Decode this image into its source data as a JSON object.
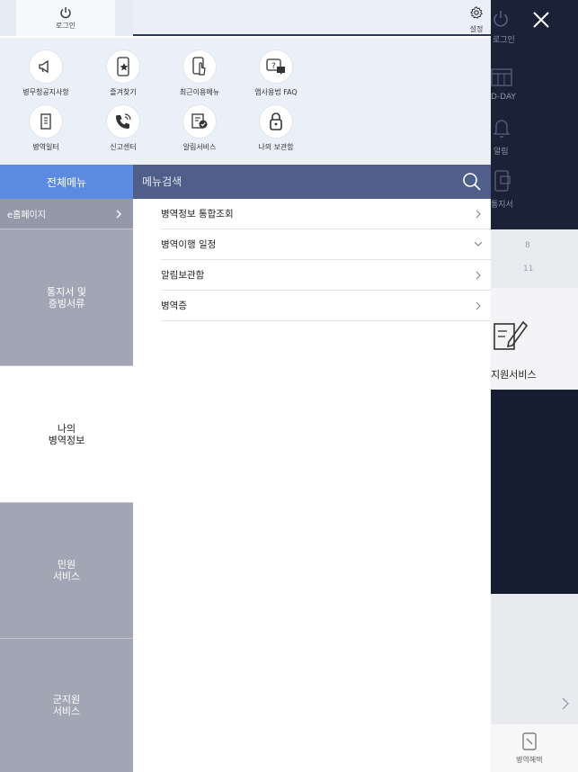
{
  "background": {
    "login_text": "로그인",
    "dday_text": "D-DAY",
    "alarm_text": "알림",
    "notice_text": "통지서",
    "dates": [
      "8",
      "11"
    ],
    "service_text": "지원서비스",
    "bottom_nav_label": "병역혜택"
  },
  "header": {
    "login_label": "로그인",
    "settings_label": "설정"
  },
  "quick_menu": [
    {
      "label": "병무청공지사항",
      "icon": "megaphone-icon"
    },
    {
      "label": "즐겨찾기",
      "icon": "phone-star-icon"
    },
    {
      "label": "최근이용메뉴",
      "icon": "phone-touch-icon"
    },
    {
      "label": "앱사용법 FAQ",
      "icon": "help-chat-icon"
    },
    {
      "label": "병역일터",
      "icon": "building-icon"
    },
    {
      "label": "신고센터",
      "icon": "phone-call-icon"
    },
    {
      "label": "알림서비스",
      "icon": "document-check-icon"
    },
    {
      "label": "나의 보관함",
      "icon": "lock-icon"
    }
  ],
  "tabs": {
    "all_menu": "전체메뉴",
    "search_placeholder": "메뉴검색"
  },
  "left_nav": {
    "ehome": "e홈페이지",
    "categories": [
      {
        "line1": "통지서 및",
        "line2": "증빙서류",
        "active": false
      },
      {
        "line1": "나의",
        "line2": "병역정보",
        "active": true
      },
      {
        "line1": "민원",
        "line2": "서비스",
        "active": false
      },
      {
        "line1": "군지원",
        "line2": "서비스",
        "active": false
      }
    ]
  },
  "submenu": [
    {
      "label": "병역정보 통합조회",
      "arrow": "right"
    },
    {
      "label": "병역이행 일정",
      "arrow": "down"
    },
    {
      "label": "알림보관함",
      "arrow": "right"
    },
    {
      "label": "병역증",
      "arrow": "right"
    }
  ]
}
